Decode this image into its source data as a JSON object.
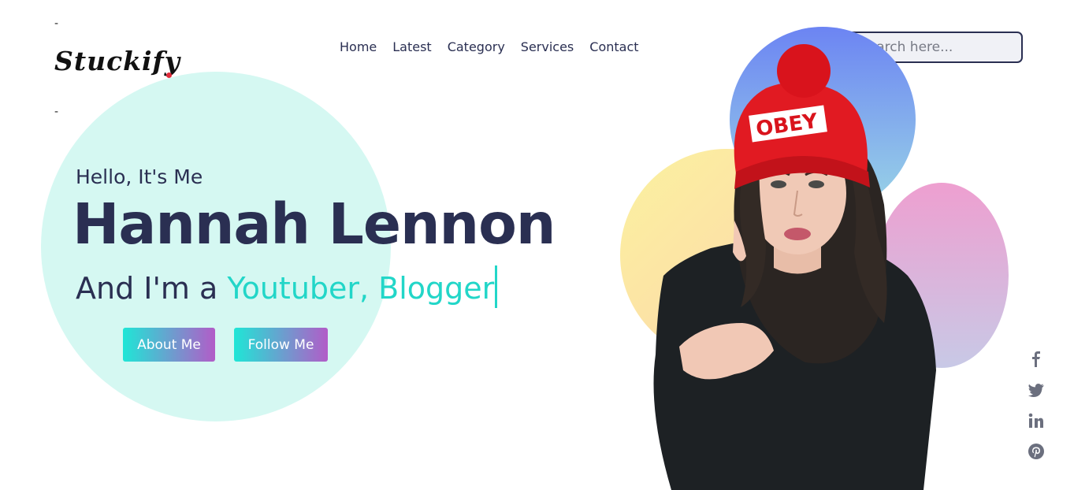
{
  "header": {
    "dash_top": "-",
    "dash_bottom": "-",
    "logo": "Stuckify"
  },
  "nav": {
    "items": [
      {
        "label": "Home"
      },
      {
        "label": "Latest"
      },
      {
        "label": "Category"
      },
      {
        "label": "Services"
      },
      {
        "label": "Contact"
      }
    ]
  },
  "search": {
    "icon": "search-icon",
    "placeholder": "Search here..."
  },
  "hero": {
    "greeting": "Hello, It's Me",
    "name": "Hannah Lennon",
    "role_prefix": "And I'm a",
    "role_highlight": "Youtuber, Blogger",
    "about_label": "About Me",
    "follow_label": "Follow Me"
  },
  "colors": {
    "primary_text": "#2a2f52",
    "accent": "#22d6c8",
    "button_gradient_start": "#1fe6d6",
    "button_gradient_end": "#b25cc8",
    "hero_circle": "#d5f8f2"
  },
  "social": {
    "icons": [
      "facebook-icon",
      "twitter-icon",
      "linkedin-icon",
      "pinterest-icon"
    ]
  },
  "portrait": {
    "hat_text": "OBEY"
  }
}
